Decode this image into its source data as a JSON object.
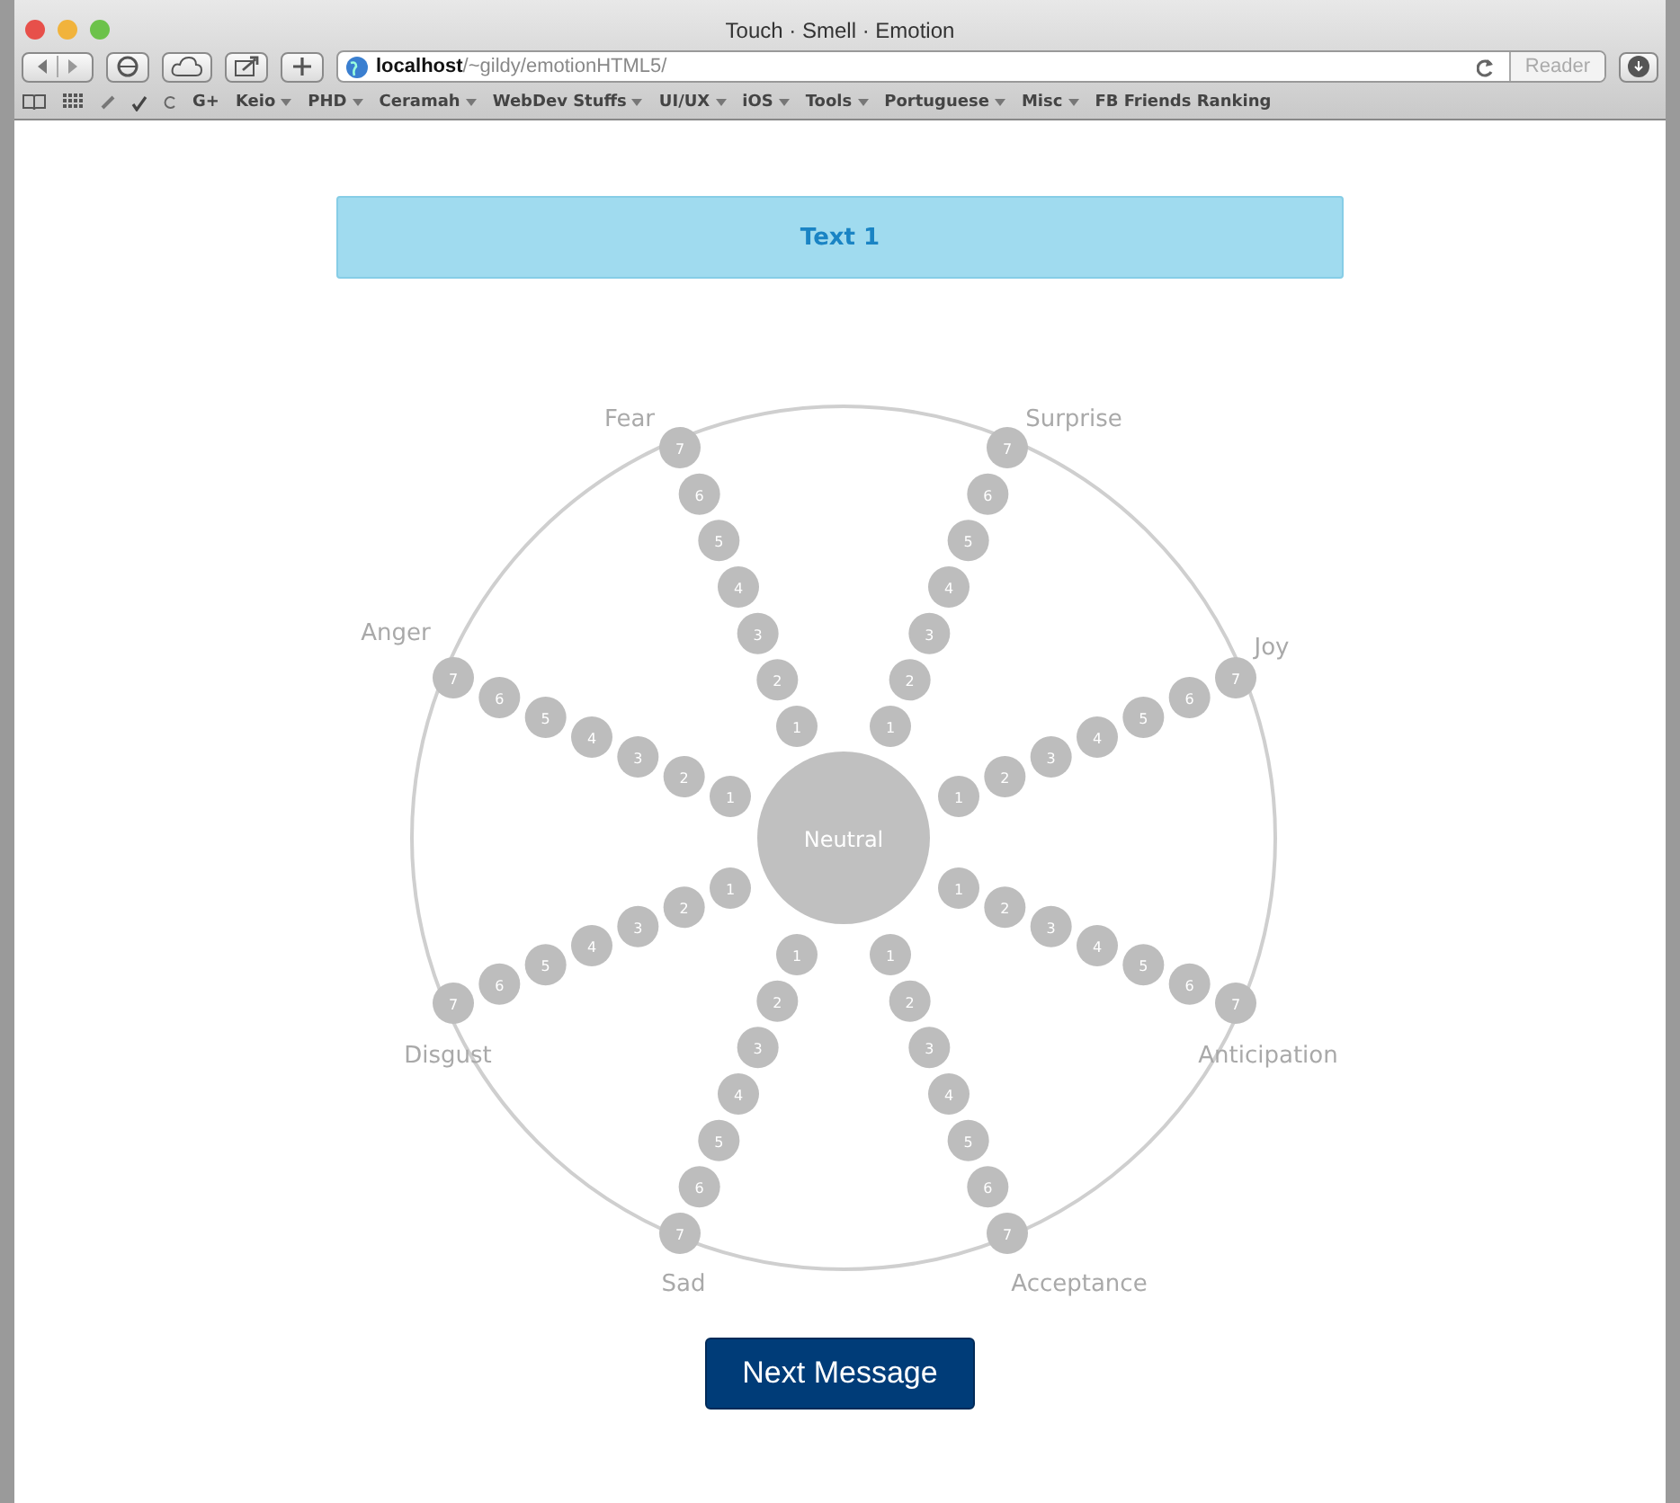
{
  "window": {
    "title": "Touch · Smell · Emotion"
  },
  "toolbar": {
    "url_host": "localhost",
    "url_path": "/~gildy/emotionHTML5/",
    "reader": "Reader"
  },
  "bookmarks": [
    {
      "label": "G+",
      "menu": false
    },
    {
      "label": "Keio",
      "menu": true
    },
    {
      "label": "PHD",
      "menu": true
    },
    {
      "label": "Ceramah",
      "menu": true
    },
    {
      "label": "WebDev Stuffs",
      "menu": true
    },
    {
      "label": "UI/UX",
      "menu": true
    },
    {
      "label": "iOS",
      "menu": true
    },
    {
      "label": "Tools",
      "menu": true
    },
    {
      "label": "Portuguese",
      "menu": true
    },
    {
      "label": "Misc",
      "menu": true
    },
    {
      "label": "FB Friends Ranking",
      "menu": false
    }
  ],
  "message": "Text 1",
  "wheel": {
    "center": "Neutral",
    "emotions": [
      {
        "label": "Fear",
        "levels": [
          "1",
          "2",
          "3",
          "4",
          "5",
          "6",
          "7"
        ]
      },
      {
        "label": "Surprise",
        "levels": [
          "1",
          "2",
          "3",
          "4",
          "5",
          "6",
          "7"
        ]
      },
      {
        "label": "Anger",
        "levels": [
          "1",
          "2",
          "3",
          "4",
          "5",
          "6",
          "7"
        ]
      },
      {
        "label": "Joy",
        "levels": [
          "1",
          "2",
          "3",
          "4",
          "5",
          "6",
          "7"
        ]
      },
      {
        "label": "Disgust",
        "levels": [
          "1",
          "2",
          "3",
          "4",
          "5",
          "6",
          "7"
        ]
      },
      {
        "label": "Anticipation",
        "levels": [
          "1",
          "2",
          "3",
          "4",
          "5",
          "6",
          "7"
        ]
      },
      {
        "label": "Sad",
        "levels": [
          "1",
          "2",
          "3",
          "4",
          "5",
          "6",
          "7"
        ]
      },
      {
        "label": "Acceptance",
        "levels": [
          "1",
          "2",
          "3",
          "4",
          "5",
          "6",
          "7"
        ]
      }
    ]
  },
  "next_button": "Next Message"
}
